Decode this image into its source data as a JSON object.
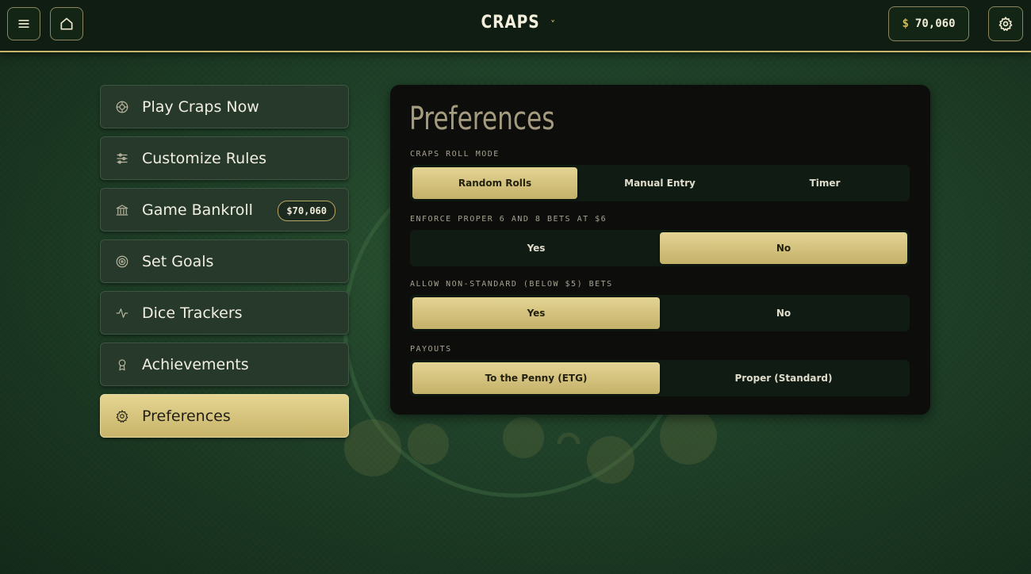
{
  "header": {
    "title": "CRAPS",
    "title_chevron": "˅",
    "bankroll_symbol": "$",
    "bankroll_amount": "70,060"
  },
  "sidebar": {
    "items": [
      {
        "label": "Play Craps Now",
        "icon": "poker-chip-icon"
      },
      {
        "label": "Customize Rules",
        "icon": "sliders-icon"
      },
      {
        "label": "Game Bankroll",
        "icon": "bank-icon",
        "badge": "$70,060"
      },
      {
        "label": "Set Goals",
        "icon": "target-icon"
      },
      {
        "label": "Dice Trackers",
        "icon": "activity-icon"
      },
      {
        "label": "Achievements",
        "icon": "award-icon"
      },
      {
        "label": "Preferences",
        "icon": "gear-icon",
        "active": true
      }
    ]
  },
  "panel": {
    "title": "Preferences",
    "sections": [
      {
        "label": "CRAPS ROLL MODE",
        "options": [
          "Random Rolls",
          "Manual Entry",
          "Timer"
        ],
        "selected": "Random Rolls"
      },
      {
        "label": "ENFORCE PROPER 6 AND 8 BETS AT $6",
        "options": [
          "Yes",
          "No"
        ],
        "selected": "No"
      },
      {
        "label": "ALLOW NON-STANDARD (BELOW $5) BETS",
        "options": [
          "Yes",
          "No"
        ],
        "selected": "Yes"
      },
      {
        "label": "PAYOUTS",
        "options": [
          "To the Penny (ETG)",
          "Proper (Standard)"
        ],
        "selected": "To the Penny (ETG)"
      }
    ]
  },
  "colors": {
    "accent_gold": "#d9c47a",
    "background_green": "#21432a",
    "panel_dark": "#0d0d0c"
  }
}
